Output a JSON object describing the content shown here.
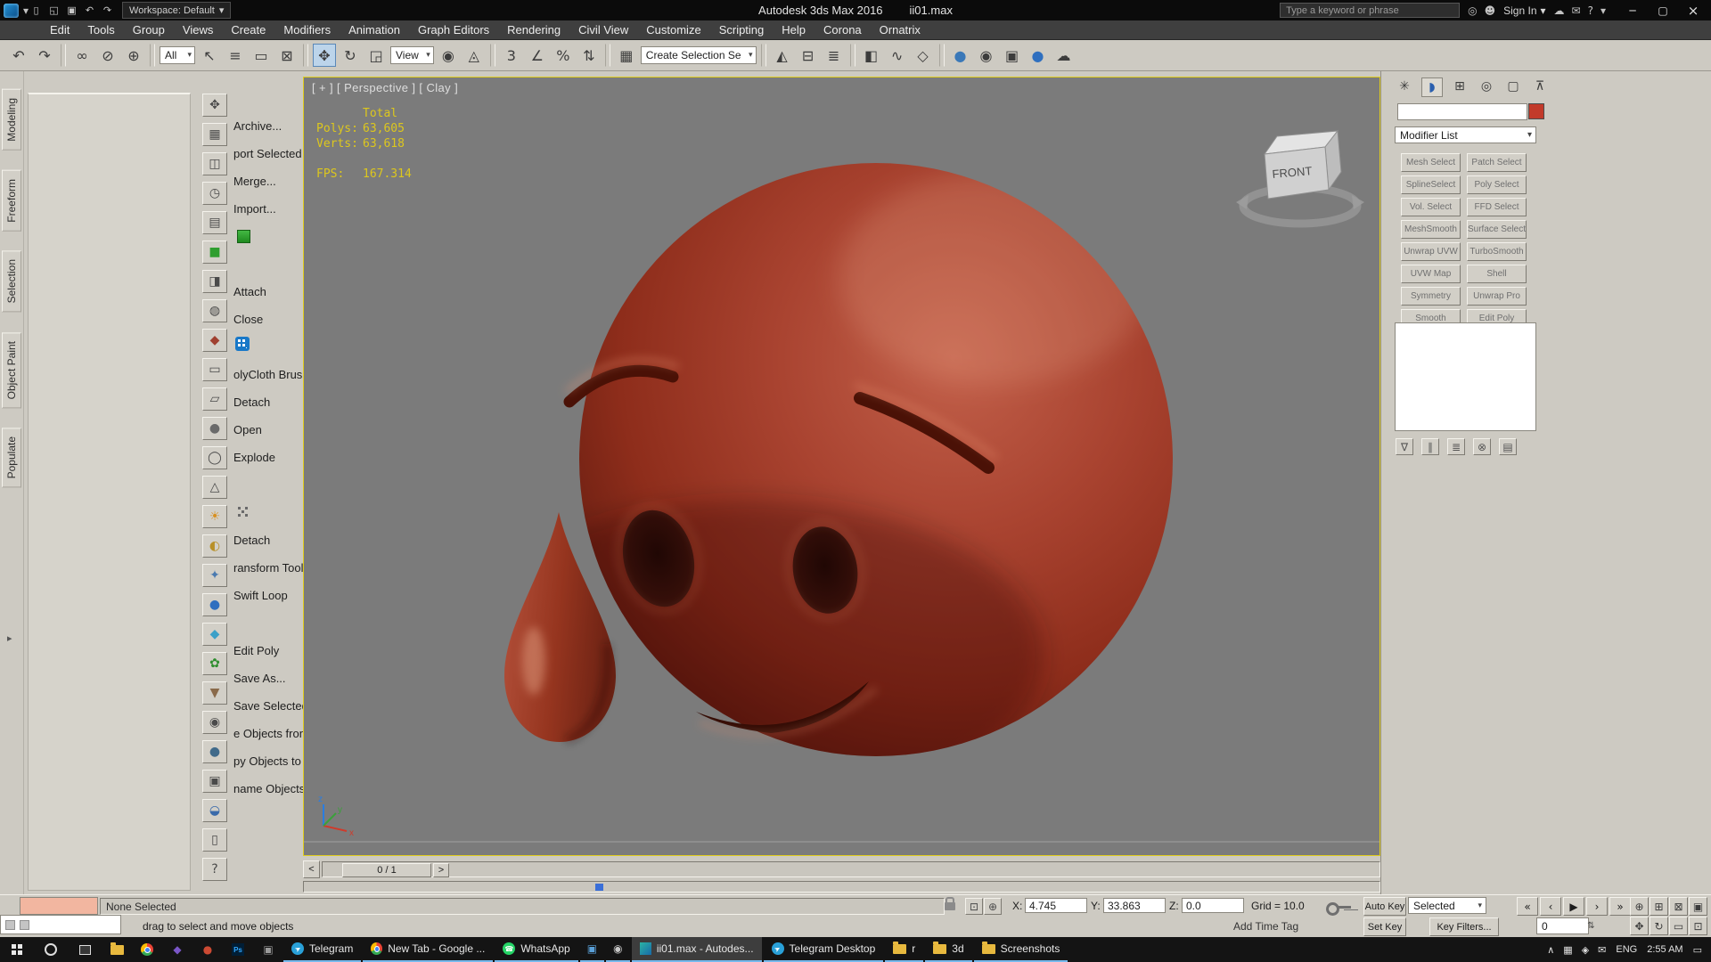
{
  "icons": {
    "caret_down": "▾",
    "minimize": "─",
    "maximize": "▢",
    "close": "×",
    "expand_arrow": "▸",
    "spinner": "⇅",
    "abs_mode": "⊡",
    "offset_mode": "⊕",
    "ps": "Ps",
    "send": "➤",
    "phone": "☎"
  },
  "titlebar": {
    "title_app": "Autodesk 3ds Max 2016",
    "title_doc": "ii01.max",
    "workspace_label": "Workspace: Default",
    "search_placeholder": "Type a keyword or phrase",
    "sign_in_label": "Sign In",
    "quick": [
      {
        "g": "▯",
        "name": "new-scene-icon"
      },
      {
        "g": "◱",
        "name": "open-file-icon"
      },
      {
        "g": "▣",
        "name": "save-file-icon"
      },
      {
        "g": "↶",
        "name": "undo-icon"
      },
      {
        "g": "↷",
        "name": "redo-icon"
      }
    ],
    "icons_a": [
      {
        "g": "◎",
        "name": "infocenter-search-icon"
      },
      {
        "g": "☻",
        "name": "user-avatar-icon"
      }
    ],
    "icons_b": [
      {
        "g": "☁",
        "name": "a360-icon"
      },
      {
        "g": "✉",
        "name": "communication-center-icon"
      },
      {
        "g": "?",
        "name": "help-icon"
      },
      {
        "g": "▾",
        "name": "help-menu-caret-icon"
      }
    ]
  },
  "menubar": {
    "items": [
      "Edit",
      "Tools",
      "Group",
      "Views",
      "Create",
      "Modifiers",
      "Animation",
      "Graph Editors",
      "Rendering",
      "Civil View",
      "Customize",
      "Scripting",
      "Help",
      "Corona",
      "Ornatrix"
    ]
  },
  "toolbar": {
    "items": [
      {
        "name": "undo-icon",
        "g": "↶"
      },
      {
        "name": "redo-icon",
        "g": "↷"
      },
      {
        "cls": "t-sep"
      },
      {
        "name": "select-and-link-icon",
        "g": "∞"
      },
      {
        "name": "unlink-selection-icon",
        "g": "⊘"
      },
      {
        "name": "bind-to-space-warp-icon",
        "g": "⊕"
      },
      {
        "cls": "t-sep"
      },
      {
        "name": "selection-filter-dropdown",
        "cls": "t-select",
        "g": "All"
      },
      {
        "name": "select-object-icon",
        "g": "↖"
      },
      {
        "name": "select-by-name-icon",
        "g": "≡"
      },
      {
        "name": "rectangular-selection-region-icon",
        "g": "▭"
      },
      {
        "name": "window-crossing-icon",
        "g": "⊠"
      },
      {
        "cls": "t-sep"
      },
      {
        "name": "select-and-move-icon",
        "g": "✥",
        "cls": "t-active"
      },
      {
        "name": "select-and-rotate-icon",
        "g": "↻"
      },
      {
        "name": "select-and-scale-icon",
        "g": "◲"
      },
      {
        "name": "reference-coordinate-dropdown",
        "cls": "t-select",
        "g": "View"
      },
      {
        "name": "use-pivot-point-center-icon",
        "g": "◉"
      },
      {
        "name": "select-and-manipulate-icon",
        "g": "◬"
      },
      {
        "cls": "t-sep"
      },
      {
        "name": "snaps-toggle-icon",
        "g": "3"
      },
      {
        "name": "angle-snap-icon",
        "g": "∠"
      },
      {
        "name": "percent-snap-icon",
        "g": "%"
      },
      {
        "name": "spinner-snap-icon",
        "g": "⇅"
      },
      {
        "cls": "t-sep"
      },
      {
        "name": "edit-named-selection-sets-icon",
        "g": "▦"
      },
      {
        "name": "named-selection-sets-dropdown",
        "cls": "t-select",
        "g": "Create Selection Se"
      },
      {
        "cls": "t-sep"
      },
      {
        "name": "mirror-icon",
        "g": "◭"
      },
      {
        "name": "align-icon",
        "g": "⊟"
      },
      {
        "name": "layer-manager-icon",
        "g": "≣"
      },
      {
        "cls": "t-sep"
      },
      {
        "name": "graphite-ribbon-icon",
        "g": "◧"
      },
      {
        "name": "curve-editor-icon",
        "g": "∿"
      },
      {
        "name": "schematic-view-icon",
        "g": "◇"
      },
      {
        "cls": "t-sep"
      },
      {
        "name": "material-editor-icon",
        "g": "●",
        "c": "#3a78b8"
      },
      {
        "name": "render-setup-icon",
        "g": "◉"
      },
      {
        "name": "rendered-frame-window-icon",
        "g": "▣"
      },
      {
        "name": "render-production-icon",
        "g": "●",
        "c": "#2f6fbf"
      },
      {
        "name": "a360-render-icon",
        "g": "☁"
      }
    ]
  },
  "ribbon": {
    "tabs": [
      "Modeling",
      "Freeform",
      "Selection",
      "Object Paint",
      "Populate"
    ]
  },
  "left_tools": {
    "icons": [
      {
        "g": "✥"
      },
      {
        "g": "▦"
      },
      {
        "g": "◫"
      },
      {
        "g": "◷"
      },
      {
        "g": "▤"
      },
      {
        "g": "■",
        "c": "#2f9e2f"
      },
      {
        "g": "◨"
      },
      {
        "g": "◍"
      },
      {
        "g": "◆",
        "c": "#a04030"
      },
      {
        "g": "▭"
      },
      {
        "g": "▱"
      },
      {
        "g": "●",
        "c": "#6a6a6a"
      },
      {
        "g": "◯"
      },
      {
        "g": "△"
      },
      {
        "g": "☀",
        "c": "#d89020"
      },
      {
        "g": "◐",
        "c": "#b89028"
      },
      {
        "g": "✦",
        "c": "#4a7ab0"
      },
      {
        "g": "●",
        "c": "#2f6fbf"
      },
      {
        "g": "◆",
        "c": "#3aa0c8"
      },
      {
        "g": "✿",
        "c": "#2f8e2f"
      },
      {
        "g": "▼",
        "c": "#8a6a4a"
      },
      {
        "g": "◉"
      },
      {
        "g": "●",
        "c": "#406a8a"
      },
      {
        "g": "▣"
      },
      {
        "g": "◒",
        "c": "#3a6aaa"
      },
      {
        "g": "▯"
      },
      {
        "g": "?"
      }
    ]
  },
  "left_menu": {
    "items": [
      "Archive...",
      "port Selected",
      "Merge...",
      "Import...",
      "",
      "",
      "Attach",
      "Close",
      "",
      "olyCloth Brush",
      "Detach",
      "Open",
      "Explode",
      "",
      "",
      "Detach",
      "ransform Tool",
      "Swift Loop",
      "",
      "Edit Poly",
      "Save As...",
      "Save Selected",
      "e Objects fron",
      "py Objects to",
      "name Objects"
    ]
  },
  "viewport": {
    "label": "[ + ] [ Perspective ] [ Clay ]",
    "stats_total_label": "Total",
    "stats": {
      "polys_label": "Polys:",
      "polys": "63,605",
      "verts_label": "Verts:",
      "verts": "63,618",
      "fps_label": "FPS:",
      "fps": "167.314"
    },
    "viewcube": "FRONT",
    "axis": {
      "x": "x",
      "y": "y",
      "z": "z"
    }
  },
  "timeline": {
    "prev": "<",
    "thumb": "0 / 1",
    "next": ">"
  },
  "status": {
    "selection": "None Selected",
    "prompt": "drag to select and move objects",
    "x_label": "X:",
    "x_value": "4.745",
    "y_label": "Y:",
    "y_value": "33.863",
    "z_label": "Z:",
    "z_value": "0.0",
    "grid": "Grid = 10.0",
    "add_time_tag": "Add Time Tag",
    "auto_key": "Auto Key",
    "set_key": "Set Key",
    "selected_filter": "Selected",
    "key_filters": "Key Filters...",
    "frame": "0"
  },
  "transport": {
    "buttons": [
      {
        "g": "«",
        "name": "go-to-start-button"
      },
      {
        "g": "‹",
        "name": "previous-frame-button"
      },
      {
        "g": "▶",
        "name": "play-button"
      },
      {
        "g": "›",
        "name": "next-frame-button"
      },
      {
        "g": "»",
        "name": "go-to-end-button"
      }
    ]
  },
  "viewnav": {
    "buttons": [
      {
        "g": "⊕",
        "name": "zoom-icon"
      },
      {
        "g": "⊞",
        "name": "zoom-all-icon"
      },
      {
        "g": "⊠",
        "name": "zoom-extents-icon"
      },
      {
        "g": "▣",
        "name": "zoom-extents-all-icon"
      },
      {
        "g": "✥",
        "name": "pan-icon"
      },
      {
        "g": "↻",
        "name": "orbit-icon"
      },
      {
        "g": "▭",
        "name": "zoom-region-icon"
      },
      {
        "g": "⊡",
        "name": "maximize-viewport-toggle-icon"
      }
    ]
  },
  "command_panel": {
    "tabs": [
      {
        "g": "✳",
        "name": "create-tab"
      },
      {
        "g": "◗",
        "name": "modify-tab",
        "cls": "active",
        "c": "#2a5fae"
      },
      {
        "g": "⊞",
        "name": "hierarchy-tab"
      },
      {
        "g": "◎",
        "name": "motion-tab"
      },
      {
        "g": "▢",
        "name": "display-tab"
      },
      {
        "g": "⊼",
        "name": "utilities-tab"
      }
    ],
    "object_name": "",
    "modifier_list_label": "Modifier List",
    "modifier_sets": [
      "Mesh Select",
      "Patch Select",
      "SplineSelect",
      "Poly Select",
      "Vol. Select",
      "FFD Select",
      "MeshSmooth",
      "Surface Select",
      "Unwrap UVW",
      "TurboSmooth",
      "UVW Map",
      "Shell",
      "Symmetry",
      "Unwrap Pro",
      "Smooth",
      "Edit Poly"
    ],
    "stack_tools": [
      {
        "g": "∇",
        "name": "pin-stack-icon"
      },
      {
        "g": "∥",
        "name": "show-end-result-icon"
      },
      {
        "g": "≣",
        "name": "make-unique-icon"
      },
      {
        "g": "⊗",
        "name": "remove-modifier-icon"
      },
      {
        "g": "▤",
        "name": "configure-modifier-sets-icon"
      }
    ]
  },
  "taskbar": {
    "apps": {
      "telegram": "Telegram",
      "chrome": "New Tab - Google ...",
      "whatsapp": "WhatsApp",
      "max": "ii01.max - Autodes...",
      "tg_desktop": "Telegram Desktop",
      "folder_r": "r",
      "folder_3d": "3d",
      "folder_ss": "Screenshots"
    },
    "tray": {
      "eng": "ENG",
      "time": "2:55 AM",
      "icons": [
        {
          "g": "∧",
          "name": "tray-expand-icon"
        },
        {
          "g": "▦",
          "name": "tray-app-icon"
        },
        {
          "g": "◈",
          "name": "network-icon"
        },
        {
          "g": "✉",
          "name": "message-icon"
        }
      ]
    }
  },
  "colors": {
    "viewport_border": "#e0cd1c",
    "emoji_red": "#a94330",
    "viewport_gray": "#7b7b7b",
    "object_color_swatch": "#c23a2a"
  }
}
